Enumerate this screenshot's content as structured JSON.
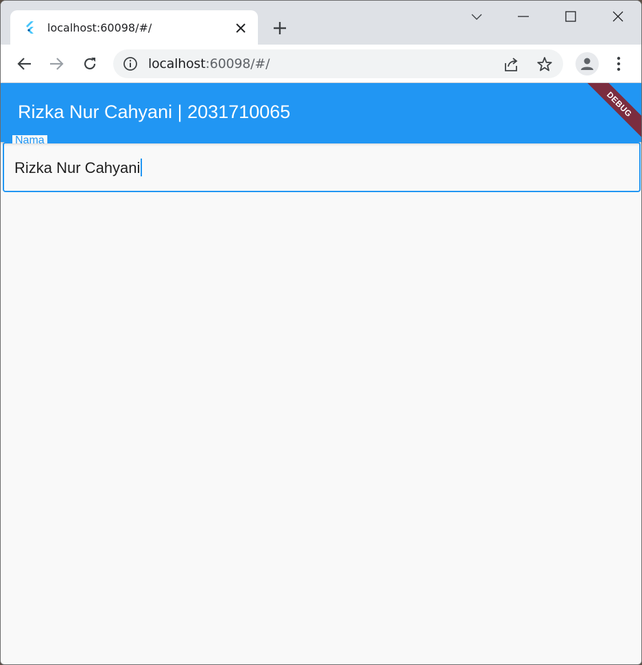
{
  "browser": {
    "tab": {
      "title": "localhost:60098/#/",
      "favicon": "flutter-logo"
    },
    "new_tab_icon": "plus-icon",
    "window_controls": [
      "chevron-down-icon",
      "minimize-icon",
      "maximize-icon",
      "close-icon"
    ],
    "address_bar": {
      "host": "localhost",
      "rest": ":60098/#/"
    }
  },
  "app": {
    "appbar_title": "Rizka Nur Cahyani | 2031710065",
    "debug_banner": "DEBUG",
    "colors": {
      "primary": "#2196f3",
      "banner": "#7b2d3f",
      "background": "#f9f9f9"
    },
    "field": {
      "label": "Nama",
      "value": "Rizka Nur Cahyani"
    }
  }
}
